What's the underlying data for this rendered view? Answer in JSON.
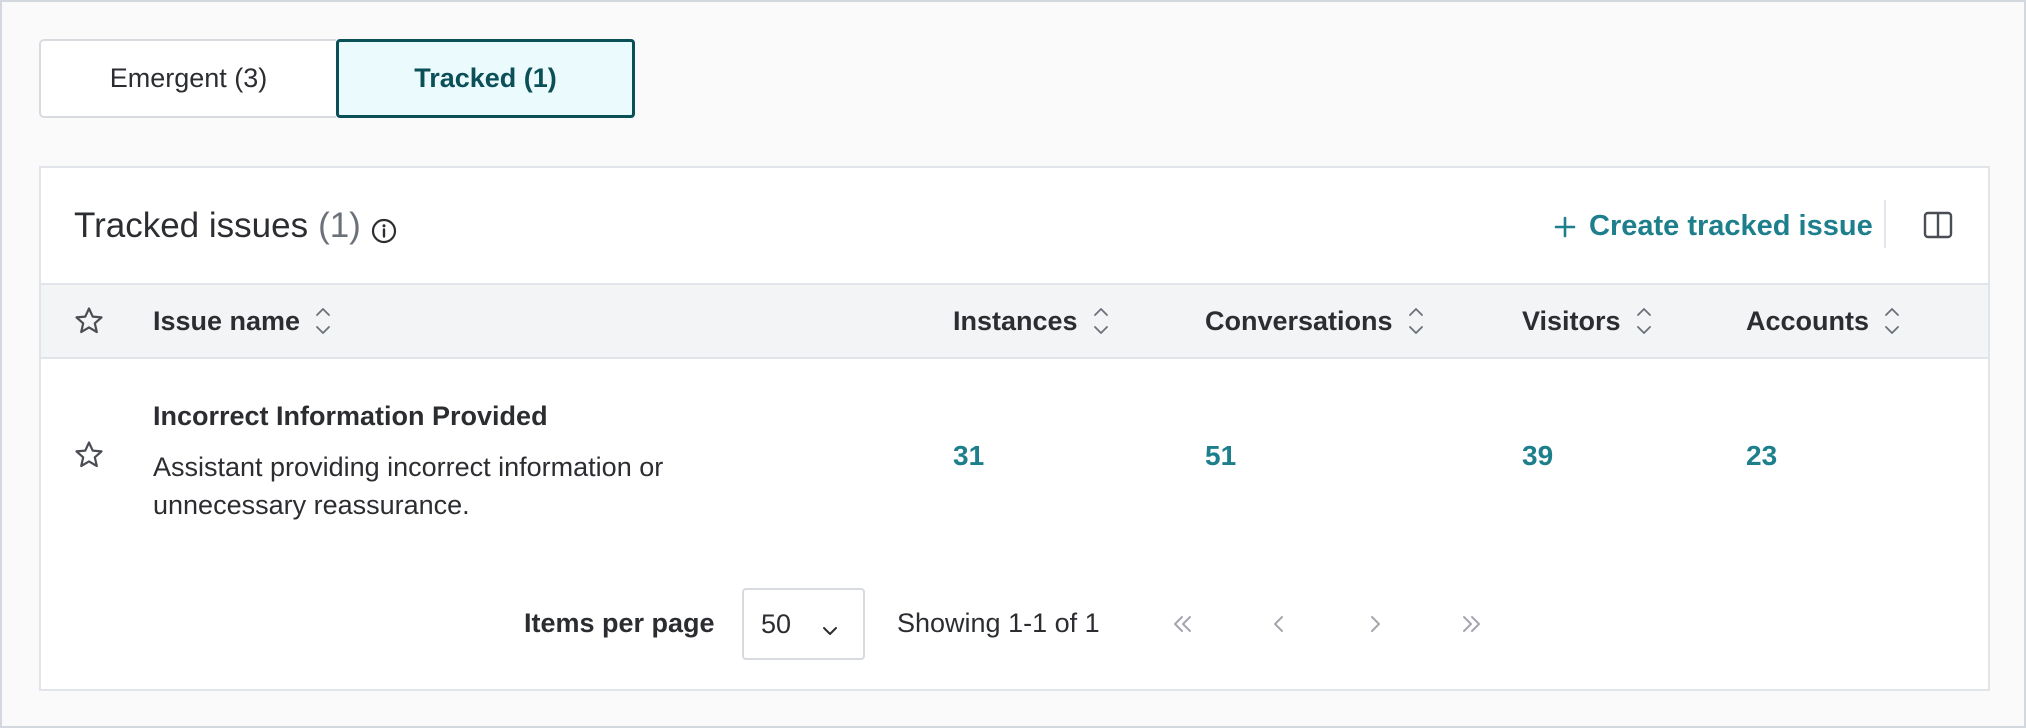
{
  "tabs": {
    "emergent_label": "Emergent (3)",
    "tracked_label": "Tracked (1)"
  },
  "card": {
    "title": "Tracked issues",
    "count": "(1)",
    "info_icon": "info-circle-icon",
    "create_label": "Create tracked issue",
    "panel_icon": "split-panel-icon"
  },
  "table": {
    "columns": [
      "Issue name",
      "Instances",
      "Conversations",
      "Visitors",
      "Accounts"
    ],
    "rows": [
      {
        "title": "Incorrect Information Provided",
        "description": "Assistant providing incorrect information or unnecessary reassurance.",
        "instances": "31",
        "conversations": "51",
        "visitors": "39",
        "accounts": "23"
      }
    ]
  },
  "pagination": {
    "items_per_page_label": "Items per page",
    "items_per_page_value": "50",
    "showing_text": "Showing 1-1 of 1"
  },
  "colors": {
    "accent": "#1e7f8c",
    "tab_active_border": "#0b4f57",
    "tab_active_bg": "#eafafd"
  }
}
